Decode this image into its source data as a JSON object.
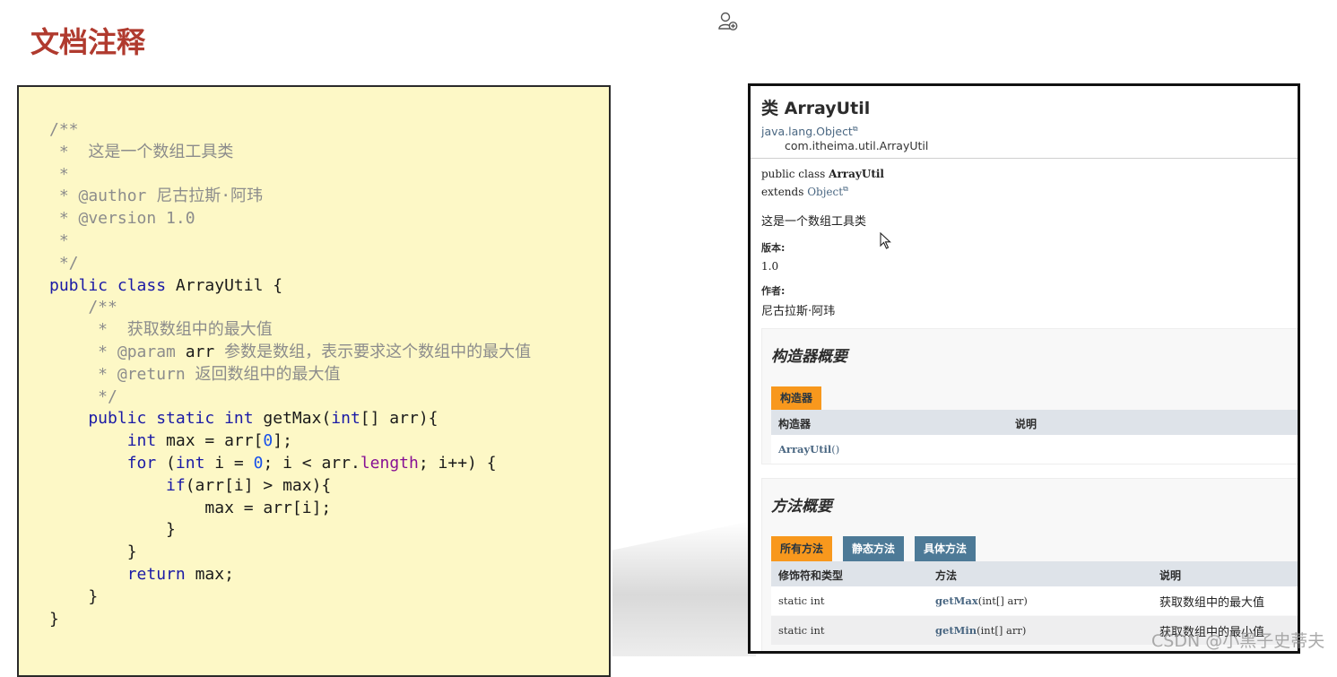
{
  "slide": {
    "title": "文档注释"
  },
  "code": {
    "lines": [
      [
        {
          "t": "/**",
          "c": "comment"
        }
      ],
      [
        {
          "t": " *  这是一个数组工具类",
          "c": "comment"
        }
      ],
      [
        {
          "t": " *",
          "c": "comment"
        }
      ],
      [
        {
          "t": " * @author 尼古拉斯·阿玮",
          "c": "comment"
        }
      ],
      [
        {
          "t": " * @version 1.0",
          "c": "comment"
        }
      ],
      [
        {
          "t": " *",
          "c": "comment"
        }
      ],
      [
        {
          "t": " */",
          "c": "comment"
        }
      ],
      [
        {
          "t": "public class ",
          "c": "keyword"
        },
        {
          "t": "ArrayUtil {",
          "c": "plain"
        }
      ],
      [
        {
          "t": "    /**",
          "c": "comment"
        }
      ],
      [
        {
          "t": "     *  获取数组中的最大值",
          "c": "comment"
        }
      ],
      [
        {
          "t": "     * @param ",
          "c": "comment"
        },
        {
          "t": "arr",
          "c": "plain"
        },
        {
          "t": " 参数是数组，表示要求这个数组中的最大值",
          "c": "comment"
        }
      ],
      [
        {
          "t": "     * @return 返回数组中的最大值",
          "c": "comment"
        }
      ],
      [
        {
          "t": "     */",
          "c": "comment"
        }
      ],
      [
        {
          "t": "    public static int ",
          "c": "keyword"
        },
        {
          "t": "getMax(",
          "c": "plain"
        },
        {
          "t": "int",
          "c": "keyword"
        },
        {
          "t": "[] arr){",
          "c": "plain"
        }
      ],
      [
        {
          "t": "        int ",
          "c": "keyword"
        },
        {
          "t": "max = arr[",
          "c": "plain"
        },
        {
          "t": "0",
          "c": "number"
        },
        {
          "t": "];",
          "c": "plain"
        }
      ],
      [
        {
          "t": "        for ",
          "c": "keyword"
        },
        {
          "t": "(",
          "c": "plain"
        },
        {
          "t": "int ",
          "c": "keyword"
        },
        {
          "t": "i = ",
          "c": "plain"
        },
        {
          "t": "0",
          "c": "number"
        },
        {
          "t": "; i < arr.",
          "c": "plain"
        },
        {
          "t": "length",
          "c": "field"
        },
        {
          "t": "; i++) {",
          "c": "plain"
        }
      ],
      [
        {
          "t": "            if",
          "c": "keyword"
        },
        {
          "t": "(arr[i] > max){",
          "c": "plain"
        }
      ],
      [
        {
          "t": "                max = arr[i];",
          "c": "plain"
        }
      ],
      [
        {
          "t": "            }",
          "c": "plain"
        }
      ],
      [
        {
          "t": "        }",
          "c": "plain"
        }
      ],
      [
        {
          "t": "        return ",
          "c": "keyword"
        },
        {
          "t": "max;",
          "c": "plain"
        }
      ],
      [
        {
          "t": "    }",
          "c": "plain"
        }
      ],
      [
        {
          "t": "}",
          "c": "plain"
        }
      ]
    ]
  },
  "javadoc": {
    "title": "类 ArrayUtil",
    "superclass": "java.lang.Object",
    "class_fqn": "com.itheima.util.ArrayUtil",
    "decl_prefix": "public class ",
    "decl_name": "ArrayUtil",
    "extends_kw": "extends ",
    "extends_link": "Object",
    "description": "这是一个数组工具类",
    "version_label": "版本:",
    "version_value": "1.0",
    "author_label": "作者:",
    "author_value": "尼古拉斯·阿玮",
    "constructor_section": {
      "heading": "构造器概要",
      "tab": "构造器",
      "col_constructor": "构造器",
      "col_desc": "说明",
      "rows": [
        {
          "name": "ArrayUtil",
          "args": "()"
        }
      ]
    },
    "method_section": {
      "heading": "方法概要",
      "tabs": [
        "所有方法",
        "静态方法",
        "具体方法"
      ],
      "col_modifier": "修饰符和类型",
      "col_method": "方法",
      "col_desc": "说明",
      "rows": [
        {
          "modifier": "static int",
          "name": "getMax",
          "params": "(int[] arr)",
          "desc": "获取数组中的最大值"
        },
        {
          "modifier": "static int",
          "name": "getMin",
          "params": "(int[] arr)",
          "desc": "获取数组中的最小值"
        }
      ]
    }
  },
  "watermark": "CSDN @小黑子史蒂夫",
  "colors": {
    "title_red": "#b03a2e",
    "tab_orange": "#f8981d",
    "tab_blue": "#4d7a97",
    "code_bg": "#fdf8c6"
  },
  "icons": {
    "top": "user-add-icon",
    "cursor": "mouse-cursor-icon"
  }
}
